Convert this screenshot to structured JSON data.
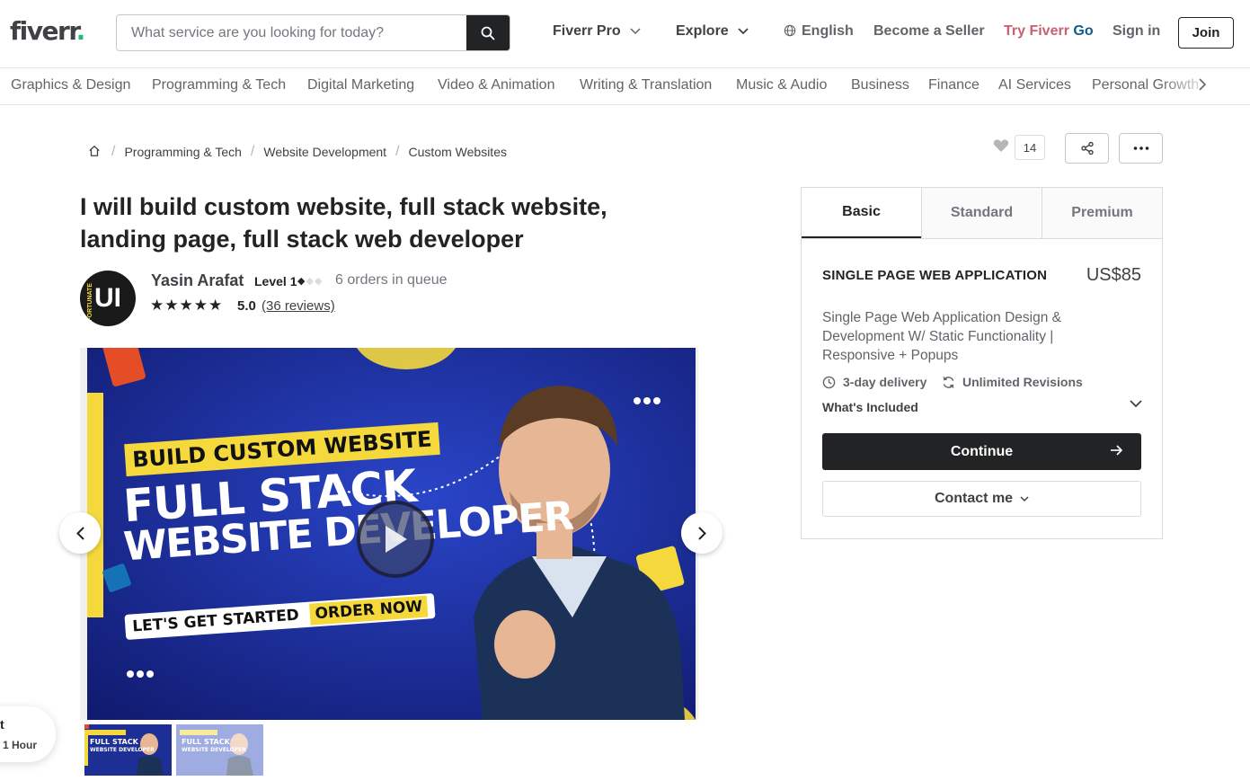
{
  "header": {
    "logo_text": "fiverr",
    "logo_dot": ".",
    "search_placeholder": "What service are you looking for today?",
    "nav": {
      "fiverr_pro": "Fiverr Pro",
      "explore": "Explore",
      "language": "English",
      "become_seller": "Become a Seller",
      "try_prefix": "Try Fiverr",
      "try_go": "Go",
      "sign_in": "Sign in",
      "join": "Join"
    }
  },
  "categories": [
    "Graphics & Design",
    "Programming & Tech",
    "Digital Marketing",
    "Video & Animation",
    "Writing & Translation",
    "Music & Audio",
    "Business",
    "Finance",
    "AI Services",
    "Personal Growth"
  ],
  "breadcrumb": [
    "Programming & Tech",
    "Website Development",
    "Custom Websites"
  ],
  "favorites_count": "14",
  "gig": {
    "title": "I will build custom website, full stack website, landing page, full stack web developer"
  },
  "seller": {
    "avatar_text": "UI",
    "avatar_small": "FORTUNATE",
    "name": "Yasin Arafat",
    "level": "Level 1",
    "level_filled": 1,
    "level_total": 3,
    "queue": "6 orders in queue",
    "stars": "★★★★★",
    "rating": "5.0",
    "reviews": "(36 reviews)"
  },
  "media": {
    "banner_top": "BUILD CUSTOM WEBSITE",
    "line1": "FULL STACK",
    "line2": "WEBSITE DEVELOPER",
    "cta_a": "LET'S GET STARTED",
    "cta_b": "ORDER NOW",
    "thumb_line1": "FULL STACK",
    "thumb_line2": "WEBSITE DEVELOPER"
  },
  "float_card": {
    "line1": "t",
    "line2": "1 Hour"
  },
  "package": {
    "tabs": [
      "Basic",
      "Standard",
      "Premium"
    ],
    "active_tab": "Basic",
    "name": "SINGLE PAGE WEB APPLICATION",
    "price": "US$85",
    "description": "Single Page Web Application Design & Development W/ Static Functionality | Responsive + Popups",
    "delivery": "3-day delivery",
    "revisions": "Unlimited Revisions",
    "included": "What's Included",
    "continue": "Continue",
    "contact": "Contact me"
  },
  "icons": {
    "search": "search-icon",
    "globe": "globe-icon",
    "home": "home-icon",
    "heart": "heart-icon",
    "share": "share-icon",
    "more": "more-icon",
    "clock": "clock-icon",
    "refresh": "refresh-icon",
    "play": "play-icon"
  },
  "colors": {
    "brand_green": "#1dbf73",
    "dark": "#222325",
    "try_red": "#c9606f",
    "go_blue": "#0d5d8c",
    "media_blue": "#1a2a8a",
    "accent_yellow": "#f4d83c"
  }
}
